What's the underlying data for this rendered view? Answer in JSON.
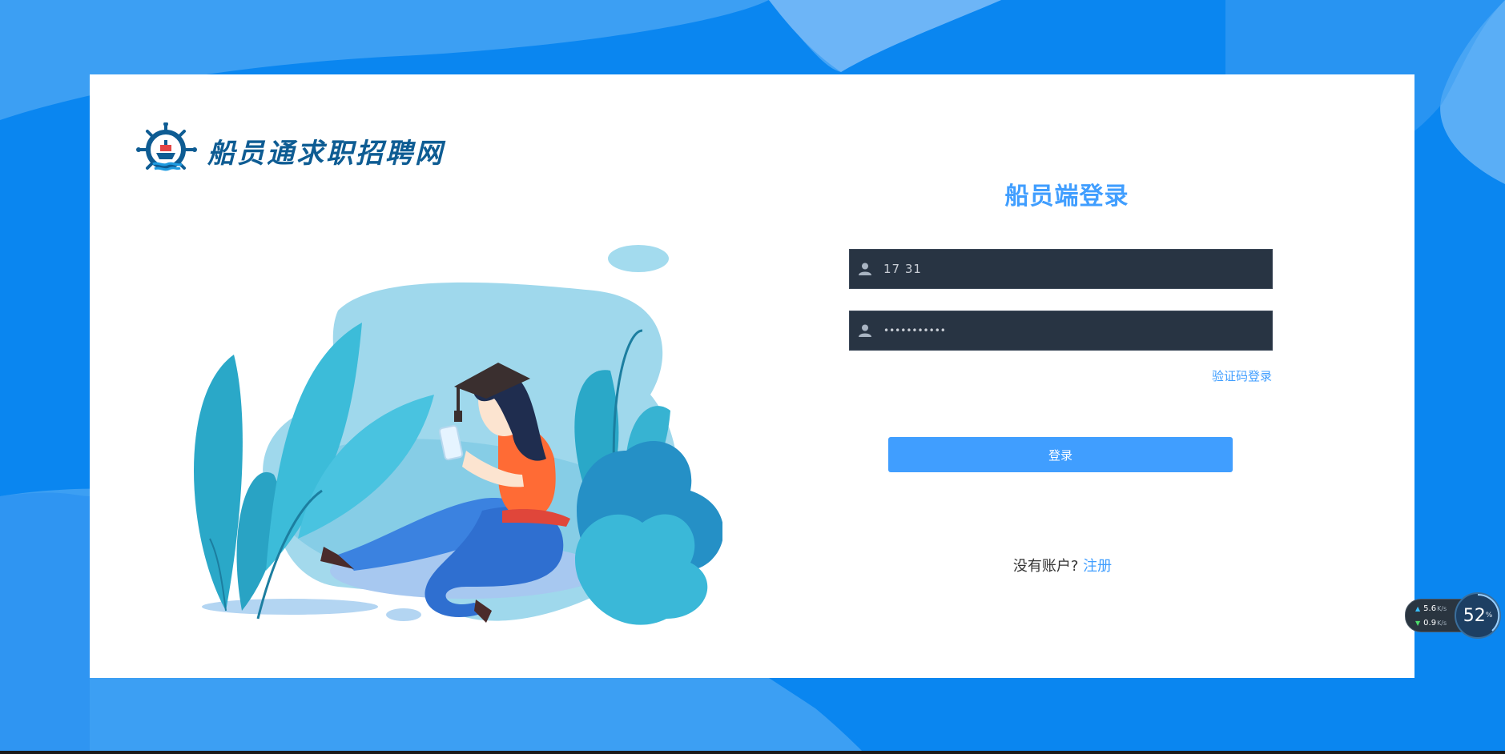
{
  "brand": {
    "name": "船员通求职招聘网"
  },
  "login": {
    "title": "船员端登录",
    "phone_value": "17           31",
    "password_value": "•••••••••••",
    "code_login_link": "验证码登录",
    "submit_label": "登录",
    "no_account_text": "没有账户?",
    "register_link": "注册"
  },
  "network_widget": {
    "upload_speed": "5.6",
    "upload_unit": "K/s",
    "download_speed": "0.9",
    "download_unit": "K/s",
    "cpu_percent": "52",
    "percent_sign": "%"
  },
  "colors": {
    "accent": "#409eff",
    "background": "#0a86f0",
    "input_bg": "#283443",
    "logo_text": "#0e5c93"
  },
  "icons": {
    "user_field": "user-icon",
    "password_field": "user-icon",
    "logo": "ship-wheel-icon"
  }
}
